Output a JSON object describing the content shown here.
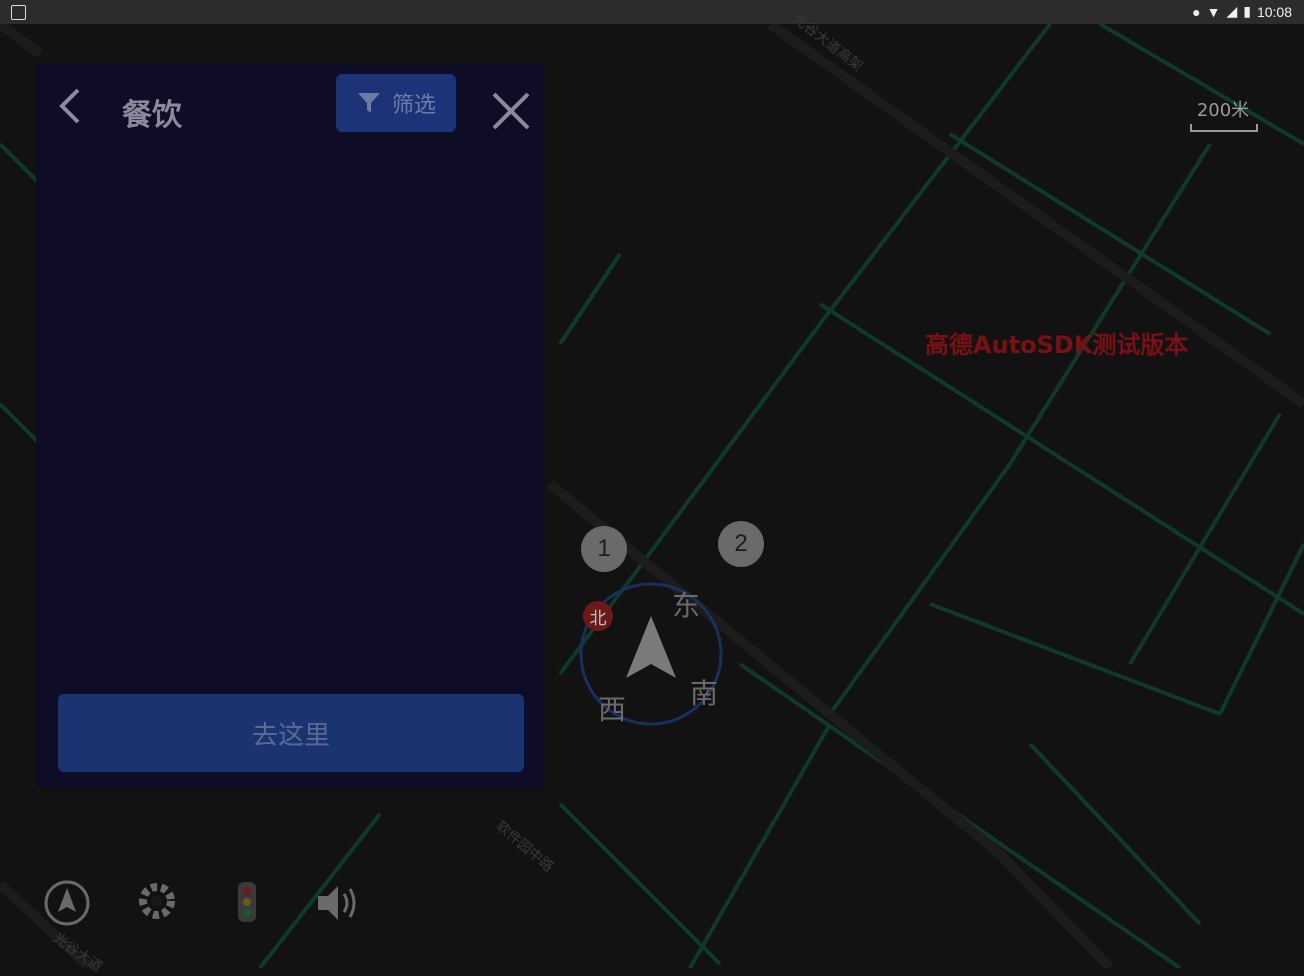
{
  "status_bar": {
    "time": "10:08"
  },
  "map": {
    "scale_label": "200米",
    "overlay_text": "高德AutoSDK测试版本",
    "roads": [
      {
        "name": "光谷大道高架"
      },
      {
        "name": "软件园中路"
      },
      {
        "name": "光谷大道"
      }
    ],
    "place_labels": []
  },
  "panel": {
    "title": "餐饮",
    "filter_label": "筛选",
    "go_button_label": "去这里"
  },
  "markers": [
    {
      "label": "1"
    },
    {
      "label": "2"
    }
  ],
  "compass": {
    "north": "北",
    "east": "东",
    "south": "南",
    "west": "西"
  },
  "toolbar": [
    {
      "icon": "compass-icon"
    },
    {
      "icon": "gear-icon"
    },
    {
      "icon": "traffic-light-icon"
    },
    {
      "icon": "volume-icon"
    }
  ]
}
